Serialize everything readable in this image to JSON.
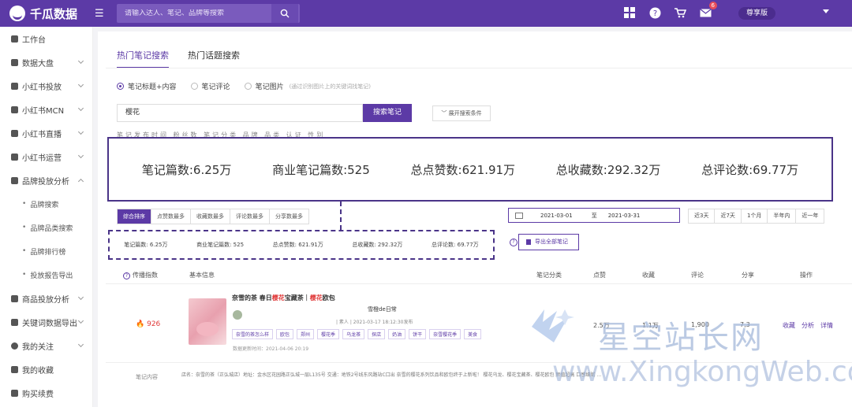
{
  "app": {
    "name": "千瓜数据"
  },
  "search": {
    "placeholder": "请输入达人、笔记、品牌等搜索"
  },
  "header": {
    "mail_badge": "6",
    "user_label": "尊享版"
  },
  "sidebar": {
    "items": [
      {
        "label": "工作台"
      },
      {
        "label": "数据大盘"
      },
      {
        "label": "小红书投放"
      },
      {
        "label": "小红书MCN"
      },
      {
        "label": "小红书直播"
      },
      {
        "label": "小红书运营"
      },
      {
        "label": "品牌投放分析"
      }
    ],
    "subitems": [
      {
        "label": "品牌搜索"
      },
      {
        "label": "品牌品类搜索"
      },
      {
        "label": "品牌排行榜"
      },
      {
        "label": "投放报告导出"
      }
    ],
    "items2": [
      {
        "label": "商品投放分析"
      },
      {
        "label": "关键词数据导出"
      },
      {
        "label": "我的关注"
      },
      {
        "label": "我的收藏"
      },
      {
        "label": "购买续费"
      }
    ]
  },
  "tabs": [
    {
      "label": "热门笔记搜索"
    },
    {
      "label": "热门话题搜索"
    }
  ],
  "radios": [
    {
      "label": "笔记标题+内容"
    },
    {
      "label": "笔记评论"
    },
    {
      "label": "笔记图片"
    }
  ],
  "radio_hint": "(通过识别图片上的关键词找笔记)",
  "keyword": {
    "value": "樱花",
    "button": "搜索笔记",
    "expand": "展开搜索条件"
  },
  "filters_cut": "笔记发布时间  粉丝数  笔记分类  品牌  品类  认证  性别",
  "stats": [
    {
      "label": "笔记篇数:",
      "value": "6.25万"
    },
    {
      "label": "商业笔记篇数:",
      "value": "525"
    },
    {
      "label": "总点赞数:",
      "value": "621.91万"
    },
    {
      "label": "总收藏数:",
      "value": "292.32万"
    },
    {
      "label": "总评论数:",
      "value": "69.77万"
    }
  ],
  "sort_tabs": [
    {
      "label": "综合排序"
    },
    {
      "label": "点赞数最多"
    },
    {
      "label": "收藏数最多"
    },
    {
      "label": "评论数最多"
    },
    {
      "label": "分享数最多"
    }
  ],
  "date_range": {
    "start": "2021-03-01",
    "sep": "至",
    "end": "2021-03-31"
  },
  "quick_ranges": [
    {
      "label": "近3天"
    },
    {
      "label": "近7天"
    },
    {
      "label": "1个月"
    },
    {
      "label": "半年内"
    },
    {
      "label": "近一年"
    }
  ],
  "export_button": "导出全部笔记",
  "table": {
    "headers": [
      "传播指数",
      "基本信息",
      "笔记分类",
      "点赞",
      "收藏",
      "评论",
      "分享",
      "操作"
    ],
    "row": {
      "score": "926",
      "title_a": "奈雪的茶",
      "title_b": " 春日",
      "title_hl1": "樱花",
      "title_c": "宝藏茶｜",
      "title_hl2": "樱花",
      "title_d": "欧包",
      "author": "雪橙de日常",
      "meta": "| 素人 | 2021-03-17 18:12:30发布",
      "tags": [
        "奈雪的茶怎么样",
        "欧包",
        "郑州",
        "樱花季",
        "乌龙茶",
        "探店",
        "奶油",
        "饼干",
        "奈雪樱花季",
        "美食"
      ],
      "updated": "数据更新时间：2021-04-06 20:19",
      "likes": "2.5万",
      "favorites": "1.1万",
      "comments": "1,900",
      "shares": "7,3",
      "ops": [
        "收藏",
        "分析",
        "详情"
      ],
      "content_label": "笔记内容",
      "content": "店名：奈雪的茶（正弘城店）地址：金水区花园路正弘城一层L135号 交通：地铁2号线东风路站C口出 奈雪的樱花系列饮品和欧包终于上新啦！ 樱花乌龙、樱花宝藏茶、樱花欧包 颜值超高 口感细腻 …"
    }
  },
  "watermark": {
    "cn": "星空站长网",
    "en": "www.XingkongWeb.com"
  }
}
